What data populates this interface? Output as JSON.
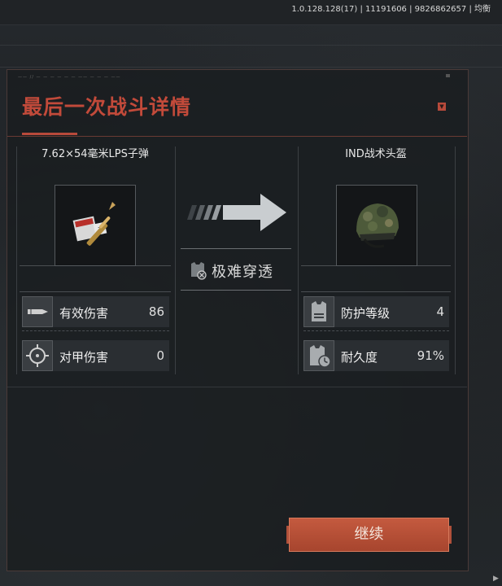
{
  "version_text": "1.0.128.128(17) | 11191606 | 9826862657 | 均衡",
  "header": {
    "deco_text": "—— // — — — — — — —— — — — ——",
    "title": "最后一次战斗详情"
  },
  "ammo": {
    "name": "7.62×54毫米LPS子弹",
    "icon": "rifle-ammo-icon",
    "stats": [
      {
        "label": "有效伤害",
        "value": "86",
        "icon": "bullet-icon"
      },
      {
        "label": "对甲伤害",
        "value": "0",
        "icon": "crosshair-icon"
      }
    ]
  },
  "armor": {
    "name": "IND战术头盔",
    "icon": "helmet-icon",
    "stats": [
      {
        "label": "防护等级",
        "value": "4",
        "icon": "vest-icon"
      },
      {
        "label": "耐久度",
        "value": "91%",
        "icon": "vest-durability-icon"
      }
    ]
  },
  "penetration": {
    "label": "极难穿透",
    "icon": "vest-blocked-icon"
  },
  "continue_label": "继续",
  "colors": {
    "accent": "#c24a3a",
    "button": "#b84f36"
  }
}
